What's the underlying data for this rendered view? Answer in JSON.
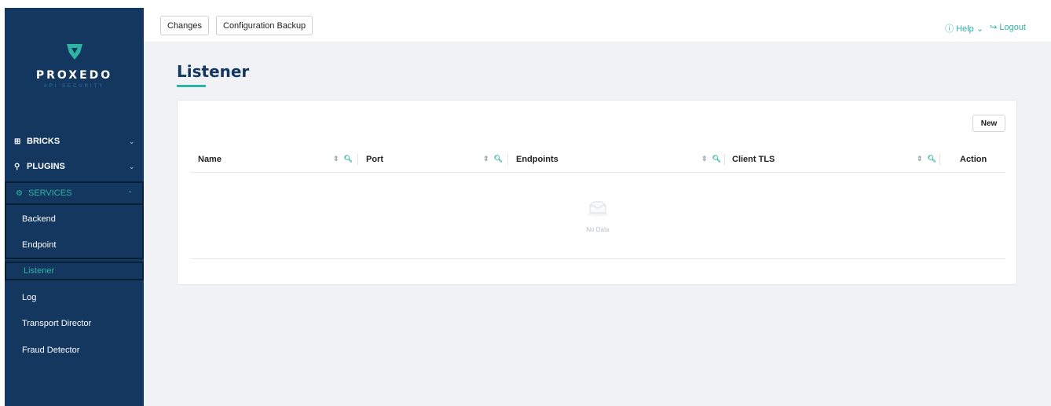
{
  "brand": {
    "name": "PROXEDO",
    "tagline": "API SECURITY"
  },
  "colors": {
    "sidebar_bg": "#14375f",
    "accent": "#2fb3a3",
    "page_bg": "#f0f2f5"
  },
  "sidebar": {
    "groups": [
      {
        "label": "BRICKS",
        "icon": "grid-icon"
      },
      {
        "label": "PLUGINS",
        "icon": "plug-icon"
      },
      {
        "label": "SERVICES",
        "icon": "gear-icon",
        "active": true
      }
    ],
    "items": [
      {
        "label": "Backend"
      },
      {
        "label": "Endpoint"
      },
      {
        "label": "Listener",
        "active": true
      },
      {
        "label": "Log"
      },
      {
        "label": "Transport Director"
      },
      {
        "label": "Fraud Detector"
      }
    ]
  },
  "toolbar": {
    "changes_label": "Changes",
    "backup_label": "Configuration Backup"
  },
  "header_right": {
    "help_label": "Help",
    "logout_label": "Logout"
  },
  "page": {
    "title": "Listener"
  },
  "card": {
    "new_label": "New"
  },
  "table": {
    "columns": [
      "Name",
      "Port",
      "Endpoints",
      "Client TLS",
      "Action"
    ],
    "empty_text": "No Data"
  }
}
